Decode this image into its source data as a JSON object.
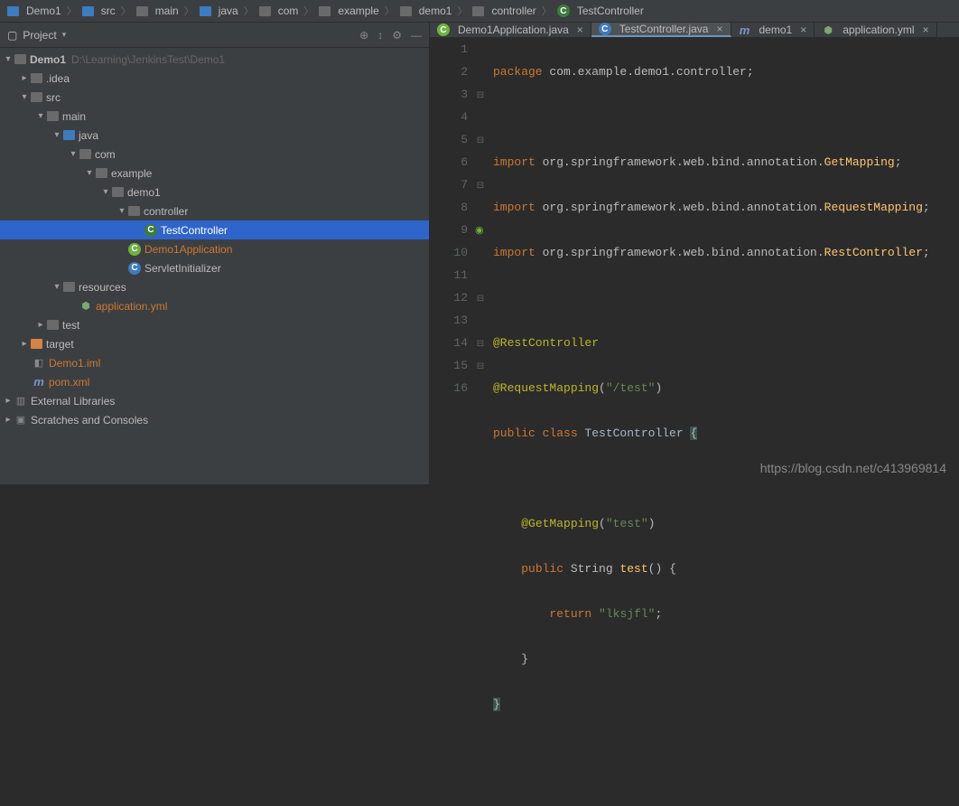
{
  "breadcrumb": [
    {
      "icon": "project",
      "label": "Demo1"
    },
    {
      "icon": "folder",
      "label": "src"
    },
    {
      "icon": "folder",
      "label": "main"
    },
    {
      "icon": "folder",
      "label": "java"
    },
    {
      "icon": "folder",
      "label": "com"
    },
    {
      "icon": "folder",
      "label": "example"
    },
    {
      "icon": "folder",
      "label": "demo1"
    },
    {
      "icon": "folder",
      "label": "controller"
    },
    {
      "icon": "class",
      "label": "TestController"
    }
  ],
  "projectPanel": {
    "title": "Project",
    "root": {
      "name": "Demo1",
      "path": "D:\\Learning\\JenkinsTest\\Demo1"
    },
    "nodes": {
      "idea": ".idea",
      "src": "src",
      "main": "main",
      "java": "java",
      "com": "com",
      "example": "example",
      "demo1": "demo1",
      "controller": "controller",
      "testController": "TestController",
      "demo1App": "Demo1Application",
      "servletInit": "ServletInitializer",
      "resources": "resources",
      "appYml": "application.yml",
      "test": "test",
      "target": "target",
      "demoIml": "Demo1.iml",
      "pomXml": "pom.xml",
      "externalLibs": "External Libraries",
      "scratches": "Scratches and Consoles"
    }
  },
  "tabs": [
    {
      "icon": "spring",
      "label": "Demo1Application.java",
      "active": false
    },
    {
      "icon": "class",
      "label": "TestController.java",
      "active": true
    },
    {
      "icon": "m",
      "label": "demo1",
      "active": false
    },
    {
      "icon": "yml",
      "label": "application.yml",
      "active": false
    }
  ],
  "gutterNumbers": [
    "1",
    "2",
    "3",
    "4",
    "5",
    "6",
    "7",
    "8",
    "9",
    "10",
    "11",
    "12",
    "13",
    "14",
    "15",
    "16"
  ],
  "code": {
    "l1": {
      "kw": "package",
      "rest": " com.example.demo1.controller;"
    },
    "l3": {
      "kw": "import",
      "mid": " org.springframework.web.bind.annotation.",
      "cls": "GetMapping",
      "end": ";"
    },
    "l4": {
      "kw": "import",
      "mid": " org.springframework.web.bind.annotation.",
      "cls": "RequestMapping",
      "end": ";"
    },
    "l5": {
      "kw": "import",
      "mid": " org.springframework.web.bind.annotation.",
      "cls": "RestController",
      "end": ";"
    },
    "l7": {
      "ann": "@RestController"
    },
    "l8": {
      "ann": "@RequestMapping",
      "paren": "(",
      "str": "\"/test\"",
      "paren2": ")"
    },
    "l9": {
      "kw": "public class",
      "cls": " TestController ",
      "brace": "{"
    },
    "l11": {
      "ann": "@GetMapping",
      "paren": "(",
      "str": "\"test\"",
      "paren2": ")"
    },
    "l12": {
      "kw": "public",
      "type": " String ",
      "method": "test",
      "rest": "() {"
    },
    "l13": {
      "kw": "return",
      "str": " \"lksjfl\"",
      "end": ";"
    },
    "l14": {
      "brace": "}"
    },
    "l15": {
      "brace": "}"
    }
  },
  "watermark": "https://blog.csdn.net/c413969814"
}
